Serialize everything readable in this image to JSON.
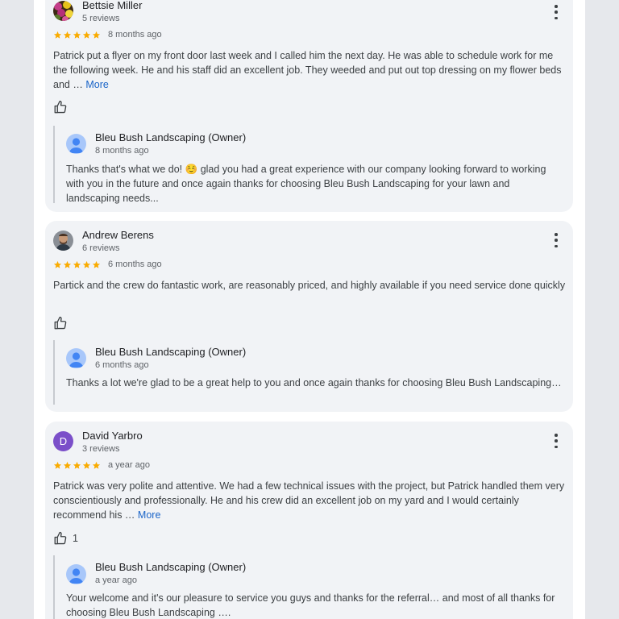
{
  "reviews": [
    {
      "name": "Bettsie Miller",
      "reviews_count": "5 reviews",
      "rating": 5,
      "time": "8 months ago",
      "text": "Patrick put a flyer on my front door last week and I called him the next day. He was able to schedule work for me the following week. He and his staff did an excellent job. They weeded and put out top dressing on my flower beds and …",
      "more_label": "More",
      "likes": "",
      "avatar_icon": "flower-photo-avatar",
      "reply": {
        "owner": "Bleu Bush Landscaping (Owner)",
        "time": "8 months ago",
        "text_before": "Thanks that's what we do!",
        "emoji": "☺️",
        "text_after": "glad you had a great experience with our company looking forward to working with you in the future and once again thanks for choosing Bleu Bush Landscaping for your lawn and landscaping needs..."
      }
    },
    {
      "name": "Andrew Berens",
      "reviews_count": "6 reviews",
      "rating": 5,
      "time": "6 months ago",
      "text": "Partick and the crew do fantastic work, are reasonably priced, and highly available if you need service done quickly",
      "likes": "",
      "avatar_icon": "man-photo-avatar",
      "reply": {
        "owner": "Bleu Bush Landscaping (Owner)",
        "time": "6 months ago",
        "text": "Thanks a lot we're glad to be a great help to you and once again thanks for choosing Bleu Bush Landscaping…"
      }
    },
    {
      "name": "David Yarbro",
      "reviews_count": "3 reviews",
      "rating": 5,
      "time": "a year ago",
      "text": "Patrick was very polite and attentive. We had a few technical issues with the project, but Patrick handled them very conscientiously and professionally. He and his crew did an excellent job on my yard and I would certainly recommend his …",
      "more_label": "More",
      "likes": "1",
      "avatar_letter": "D",
      "avatar_color": "#7b4fc9",
      "reply": {
        "owner": "Bleu Bush Landscaping (Owner)",
        "time": "a year ago",
        "text": "Your welcome and it's our pleasure to service you guys and thanks for the referral… and most of all thanks for choosing Bleu Bush Landscaping …."
      }
    }
  ],
  "colors": {
    "star": "#f9ab00",
    "more_link": "#1a64c8",
    "card_bg": "#f1f3f6",
    "owner_avatar_bg": "#a8c7fa",
    "owner_avatar_fg": "#4285f4"
  }
}
